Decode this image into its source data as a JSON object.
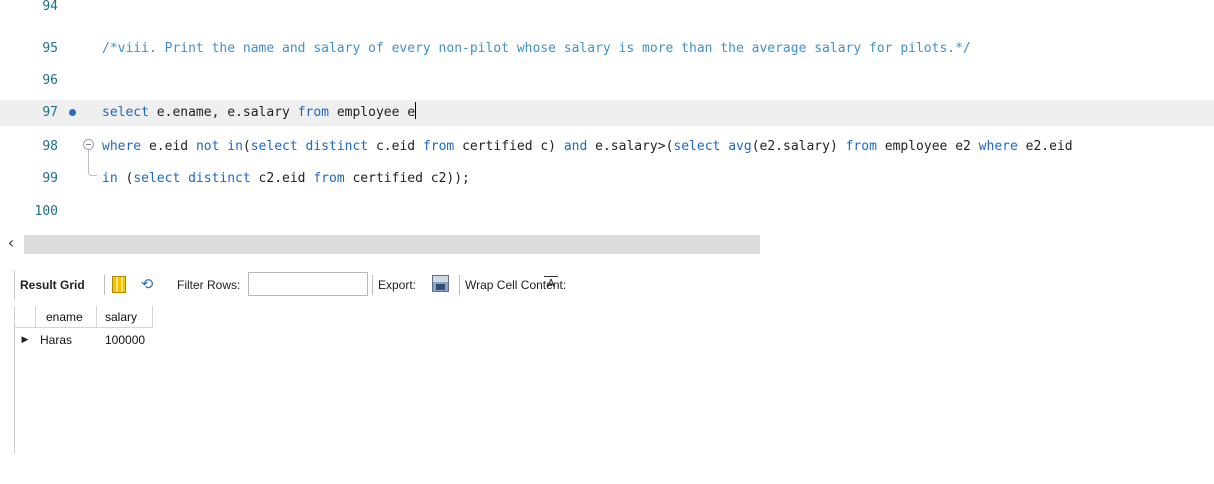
{
  "editor": {
    "lines": [
      {
        "num": "94",
        "tokens": []
      },
      {
        "num": "95",
        "tokens": [
          {
            "t": "/*viii. Print the name and salary of every non-pilot whose salary is more than the average salary for pilots.*/",
            "c": "cm"
          }
        ]
      },
      {
        "num": "96",
        "tokens": []
      },
      {
        "num": "97",
        "marker": "breakpoint-dot",
        "current": true,
        "tokens": [
          {
            "t": "select",
            "c": "kw"
          },
          {
            "t": " e.ename, e.salary "
          },
          {
            "t": "from",
            "c": "kw"
          },
          {
            "t": " employee e"
          }
        ]
      },
      {
        "num": "98",
        "fold": "open",
        "tokens": [
          {
            "t": "where",
            "c": "kw"
          },
          {
            "t": " e.eid "
          },
          {
            "t": "not in",
            "c": "kw"
          },
          {
            "t": "("
          },
          {
            "t": "select distinct",
            "c": "kw"
          },
          {
            "t": " c.eid "
          },
          {
            "t": "from",
            "c": "kw"
          },
          {
            "t": " certified c) "
          },
          {
            "t": "and",
            "c": "kw"
          },
          {
            "t": " e.salary>("
          },
          {
            "t": "select avg",
            "c": "kw"
          },
          {
            "t": "(e2.salary) "
          },
          {
            "t": "from",
            "c": "kw"
          },
          {
            "t": " employee e2 "
          },
          {
            "t": "where",
            "c": "kw"
          },
          {
            "t": " e2.eid"
          }
        ]
      },
      {
        "num": "99",
        "fold": "end",
        "tokens": [
          {
            "t": "in",
            "c": "kw"
          },
          {
            "t": " ("
          },
          {
            "t": "select distinct",
            "c": "kw"
          },
          {
            "t": " c2.eid "
          },
          {
            "t": "from",
            "c": "kw"
          },
          {
            "t": " certified c2));"
          }
        ]
      },
      {
        "num": "100",
        "tokens": []
      }
    ]
  },
  "scrollbar": {
    "left_arrow": "‹"
  },
  "result_toolbar": {
    "result_grid_label": "Result Grid",
    "filter_rows_label": "Filter Rows:",
    "filter_value": "",
    "export_label": "Export:",
    "wrap_label": "Wrap Cell Content:",
    "icons": [
      "grid-layout-icon",
      "refresh-icon",
      "export-icon",
      "wrap-cell-icon"
    ]
  },
  "result_grid": {
    "columns": [
      "ename",
      "salary"
    ],
    "row_marker": "▶",
    "rows": [
      [
        "Haras",
        "100000"
      ]
    ]
  },
  "colors": {
    "keyword": "#1c68c4",
    "comment": "#3f92c9",
    "line_number": "#1f6f8b",
    "current_line": "#efefef"
  }
}
